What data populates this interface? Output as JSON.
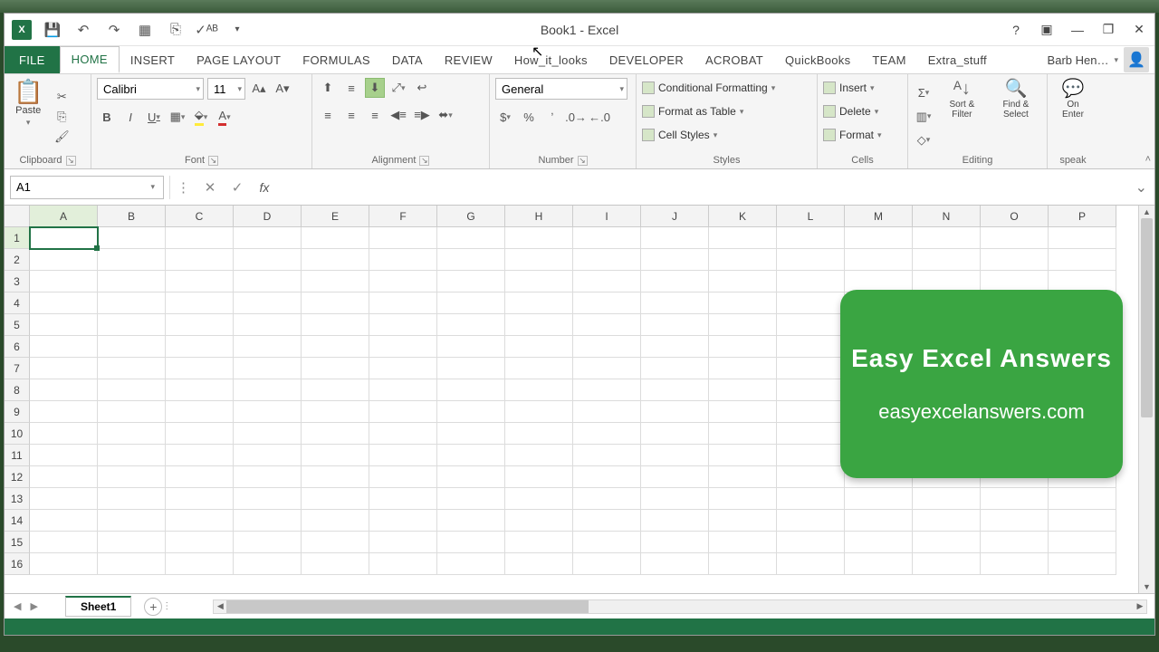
{
  "title": "Book1 - Excel",
  "qat": {
    "excel": "X",
    "save": "💾",
    "undo": "↶",
    "redo": "↷",
    "preview": "▦",
    "repeat": "⎘",
    "spell": "✓ᴬᴮ",
    "more": "▾"
  },
  "winctrl": {
    "help": "?",
    "ribbon_opts": "▣",
    "min": "—",
    "restore": "❐",
    "close": "✕"
  },
  "tabs": [
    "FILE",
    "HOME",
    "INSERT",
    "PAGE LAYOUT",
    "FORMULAS",
    "DATA",
    "REVIEW",
    "How_it_looks",
    "DEVELOPER",
    "ACROBAT",
    "QuickBooks",
    "TEAM",
    "Extra_stuff"
  ],
  "user": "Barb Hen…",
  "ribbon": {
    "clipboard": {
      "label": "Clipboard",
      "paste": "Paste"
    },
    "font": {
      "label": "Font",
      "name": "Calibri",
      "size": "11"
    },
    "alignment": {
      "label": "Alignment"
    },
    "number": {
      "label": "Number",
      "format": "General"
    },
    "styles": {
      "label": "Styles",
      "cond": "Conditional Formatting",
      "table": "Format as Table",
      "cell": "Cell Styles"
    },
    "cells": {
      "label": "Cells",
      "insert": "Insert",
      "delete": "Delete",
      "format": "Format"
    },
    "editing": {
      "label": "Editing",
      "sort": "Sort & Filter",
      "find": "Find & Select"
    },
    "speak": {
      "label": "speak",
      "btn": "On Enter"
    }
  },
  "namebox": "A1",
  "columns": [
    "A",
    "B",
    "C",
    "D",
    "E",
    "F",
    "G",
    "H",
    "I",
    "J",
    "K",
    "L",
    "M",
    "N",
    "O",
    "P"
  ],
  "rows": [
    "1",
    "2",
    "3",
    "4",
    "5",
    "6",
    "7",
    "8",
    "9",
    "10",
    "11",
    "12",
    "13",
    "14",
    "15",
    "16"
  ],
  "selected_cell": "A1",
  "sheet": {
    "name": "Sheet1"
  },
  "banner": {
    "line1": "Easy Excel Answers",
    "line2": "easyexcelanswers.com"
  }
}
